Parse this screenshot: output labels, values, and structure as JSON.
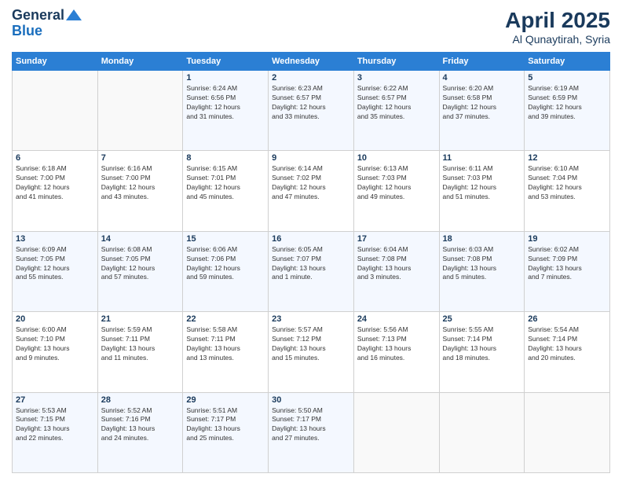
{
  "header": {
    "logo_line1": "General",
    "logo_line2": "Blue",
    "month": "April 2025",
    "location": "Al Qunaytirah, Syria"
  },
  "weekdays": [
    "Sunday",
    "Monday",
    "Tuesday",
    "Wednesday",
    "Thursday",
    "Friday",
    "Saturday"
  ],
  "weeks": [
    [
      {
        "day": "",
        "detail": ""
      },
      {
        "day": "",
        "detail": ""
      },
      {
        "day": "1",
        "detail": "Sunrise: 6:24 AM\nSunset: 6:56 PM\nDaylight: 12 hours\nand 31 minutes."
      },
      {
        "day": "2",
        "detail": "Sunrise: 6:23 AM\nSunset: 6:57 PM\nDaylight: 12 hours\nand 33 minutes."
      },
      {
        "day": "3",
        "detail": "Sunrise: 6:22 AM\nSunset: 6:57 PM\nDaylight: 12 hours\nand 35 minutes."
      },
      {
        "day": "4",
        "detail": "Sunrise: 6:20 AM\nSunset: 6:58 PM\nDaylight: 12 hours\nand 37 minutes."
      },
      {
        "day": "5",
        "detail": "Sunrise: 6:19 AM\nSunset: 6:59 PM\nDaylight: 12 hours\nand 39 minutes."
      }
    ],
    [
      {
        "day": "6",
        "detail": "Sunrise: 6:18 AM\nSunset: 7:00 PM\nDaylight: 12 hours\nand 41 minutes."
      },
      {
        "day": "7",
        "detail": "Sunrise: 6:16 AM\nSunset: 7:00 PM\nDaylight: 12 hours\nand 43 minutes."
      },
      {
        "day": "8",
        "detail": "Sunrise: 6:15 AM\nSunset: 7:01 PM\nDaylight: 12 hours\nand 45 minutes."
      },
      {
        "day": "9",
        "detail": "Sunrise: 6:14 AM\nSunset: 7:02 PM\nDaylight: 12 hours\nand 47 minutes."
      },
      {
        "day": "10",
        "detail": "Sunrise: 6:13 AM\nSunset: 7:03 PM\nDaylight: 12 hours\nand 49 minutes."
      },
      {
        "day": "11",
        "detail": "Sunrise: 6:11 AM\nSunset: 7:03 PM\nDaylight: 12 hours\nand 51 minutes."
      },
      {
        "day": "12",
        "detail": "Sunrise: 6:10 AM\nSunset: 7:04 PM\nDaylight: 12 hours\nand 53 minutes."
      }
    ],
    [
      {
        "day": "13",
        "detail": "Sunrise: 6:09 AM\nSunset: 7:05 PM\nDaylight: 12 hours\nand 55 minutes."
      },
      {
        "day": "14",
        "detail": "Sunrise: 6:08 AM\nSunset: 7:05 PM\nDaylight: 12 hours\nand 57 minutes."
      },
      {
        "day": "15",
        "detail": "Sunrise: 6:06 AM\nSunset: 7:06 PM\nDaylight: 12 hours\nand 59 minutes."
      },
      {
        "day": "16",
        "detail": "Sunrise: 6:05 AM\nSunset: 7:07 PM\nDaylight: 13 hours\nand 1 minute."
      },
      {
        "day": "17",
        "detail": "Sunrise: 6:04 AM\nSunset: 7:08 PM\nDaylight: 13 hours\nand 3 minutes."
      },
      {
        "day": "18",
        "detail": "Sunrise: 6:03 AM\nSunset: 7:08 PM\nDaylight: 13 hours\nand 5 minutes."
      },
      {
        "day": "19",
        "detail": "Sunrise: 6:02 AM\nSunset: 7:09 PM\nDaylight: 13 hours\nand 7 minutes."
      }
    ],
    [
      {
        "day": "20",
        "detail": "Sunrise: 6:00 AM\nSunset: 7:10 PM\nDaylight: 13 hours\nand 9 minutes."
      },
      {
        "day": "21",
        "detail": "Sunrise: 5:59 AM\nSunset: 7:11 PM\nDaylight: 13 hours\nand 11 minutes."
      },
      {
        "day": "22",
        "detail": "Sunrise: 5:58 AM\nSunset: 7:11 PM\nDaylight: 13 hours\nand 13 minutes."
      },
      {
        "day": "23",
        "detail": "Sunrise: 5:57 AM\nSunset: 7:12 PM\nDaylight: 13 hours\nand 15 minutes."
      },
      {
        "day": "24",
        "detail": "Sunrise: 5:56 AM\nSunset: 7:13 PM\nDaylight: 13 hours\nand 16 minutes."
      },
      {
        "day": "25",
        "detail": "Sunrise: 5:55 AM\nSunset: 7:14 PM\nDaylight: 13 hours\nand 18 minutes."
      },
      {
        "day": "26",
        "detail": "Sunrise: 5:54 AM\nSunset: 7:14 PM\nDaylight: 13 hours\nand 20 minutes."
      }
    ],
    [
      {
        "day": "27",
        "detail": "Sunrise: 5:53 AM\nSunset: 7:15 PM\nDaylight: 13 hours\nand 22 minutes."
      },
      {
        "day": "28",
        "detail": "Sunrise: 5:52 AM\nSunset: 7:16 PM\nDaylight: 13 hours\nand 24 minutes."
      },
      {
        "day": "29",
        "detail": "Sunrise: 5:51 AM\nSunset: 7:17 PM\nDaylight: 13 hours\nand 25 minutes."
      },
      {
        "day": "30",
        "detail": "Sunrise: 5:50 AM\nSunset: 7:17 PM\nDaylight: 13 hours\nand 27 minutes."
      },
      {
        "day": "",
        "detail": ""
      },
      {
        "day": "",
        "detail": ""
      },
      {
        "day": "",
        "detail": ""
      }
    ]
  ]
}
